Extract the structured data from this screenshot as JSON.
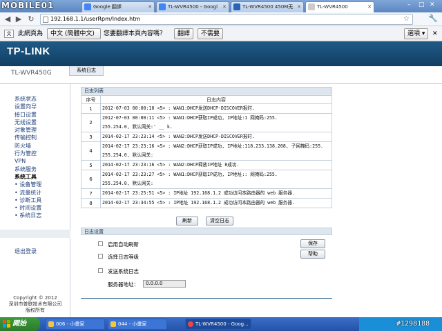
{
  "watermark": {
    "logo_text": "MOBILE01",
    "post_id": "#1298188"
  },
  "browser": {
    "tabs": [
      {
        "label": "Google 翻譯",
        "icon_color": "#4285f4"
      },
      {
        "label": "TL-WVR4500 - Googl",
        "icon_color": "#4285f4"
      },
      {
        "label": "TL-WVR4500 450M无",
        "icon_color": "#2a62b8"
      },
      {
        "label": "TL-WVR4500",
        "icon_color": "#cccccc"
      }
    ],
    "url": "192.168.1.1/userRpm/Index.htm",
    "translate_bar": {
      "prefix": "此網頁為",
      "language": "中文 (簡體中文)",
      "question": "您要翻譯本頁內容嗎？",
      "translate_button": "翻譯",
      "no_button": "不需要",
      "options_button": "選項"
    }
  },
  "router": {
    "brand": "TP-LINK",
    "model": "TL-WVR450G",
    "main_tab": "系统日志",
    "menu": [
      {
        "label": "系统状态",
        "type": "item"
      },
      {
        "label": "设置向导",
        "type": "item"
      },
      {
        "label": "接口设置",
        "type": "item"
      },
      {
        "label": "无线设置",
        "type": "item"
      },
      {
        "label": "对象管理",
        "type": "item"
      },
      {
        "label": "传输控制",
        "type": "item"
      },
      {
        "label": "防火墙",
        "type": "item"
      },
      {
        "label": "行为管控",
        "type": "item"
      },
      {
        "label": "VPN",
        "type": "item"
      },
      {
        "label": "系统服务",
        "type": "item"
      },
      {
        "label": "系统工具",
        "type": "sec"
      },
      {
        "label": "• 设备管理",
        "type": "sub"
      },
      {
        "label": "• 流量统计",
        "type": "sub"
      },
      {
        "label": "• 诊断工具",
        "type": "sub"
      },
      {
        "label": "• 时间设置",
        "type": "sub"
      },
      {
        "label": "• 系统日志",
        "type": "sub"
      }
    ],
    "logout": "退出登录",
    "copyright": [
      "Copyright © 2012",
      "深圳市普联技术有限公司",
      "版权所有"
    ],
    "log_panel": {
      "title": "日志列表",
      "col_index": "序号",
      "col_content": "日志内容",
      "rows": [
        {
          "idx": "1",
          "lines": [
            "2012-07-03 00:00:10 <5> : WAN1:DHCP发送DHCP-DISCOVER报时."
          ]
        },
        {
          "idx": "2",
          "lines": [
            "2012-07-03 00:00:11 <5> : WAN1:DHCP获取IP成功, IP地址:1              网掩码:255.",
            "255.254.0, 默认网关:'  __      k."
          ]
        },
        {
          "idx": "3",
          "lines": [
            "2014-02-17 23:23:14 <5> : WAN2:DHCP发送DHCP-DISCOVER报时."
          ]
        },
        {
          "idx": "4",
          "lines": [
            "2014-02-17 23:23:16 <5> : WAN2:DHCP获取IP成功, IP地址:118.233.138.208, 子网掩码:255.",
            "255.254.0, 默认网关:"
          ]
        },
        {
          "idx": "5",
          "lines": [
            "2014-02-17 23:23:16 <5> : WAN2:DHCP释放IP地址          8成功."
          ]
        },
        {
          "idx": "6",
          "lines": [
            "2014-02-17 23:23:27 <5> : WAN1:DHCP获取IP成功, IP地址::            网掩码:255.",
            "255.254.0, 默认网关:"
          ]
        },
        {
          "idx": "7",
          "lines": [
            "2014-02-17 23:25:51 <5> : IP地址 192.168.1.2 成功访问本路由器的 web 服务器."
          ]
        },
        {
          "idx": "8",
          "lines": [
            "2014-02-17 23:34:55 <5> : IP地址 192.168.1.2 成功访问本路由器的 web 服务器."
          ]
        }
      ],
      "refresh_button": "刷新",
      "clear_button": "清空日志"
    },
    "log_settings": {
      "title": "日志设置",
      "auto_refresh": "启用自动刷新",
      "select_level": "选择日志等级",
      "send_syslog": "发送系统日志",
      "server_label": "服务器地址：",
      "server_value": "0.0.0.0",
      "save_button": "保存",
      "help_button": "帮助"
    }
  },
  "taskbar": {
    "start_label": "開始",
    "tasks": [
      {
        "label": "006 - 小畫家",
        "icon_color": "#f4c542"
      },
      {
        "label": "044 - 小畫家",
        "icon_color": "#f4c542"
      },
      {
        "label": "TL-WVR4500 - Goog...",
        "icon_color": "#e44"
      }
    ]
  }
}
